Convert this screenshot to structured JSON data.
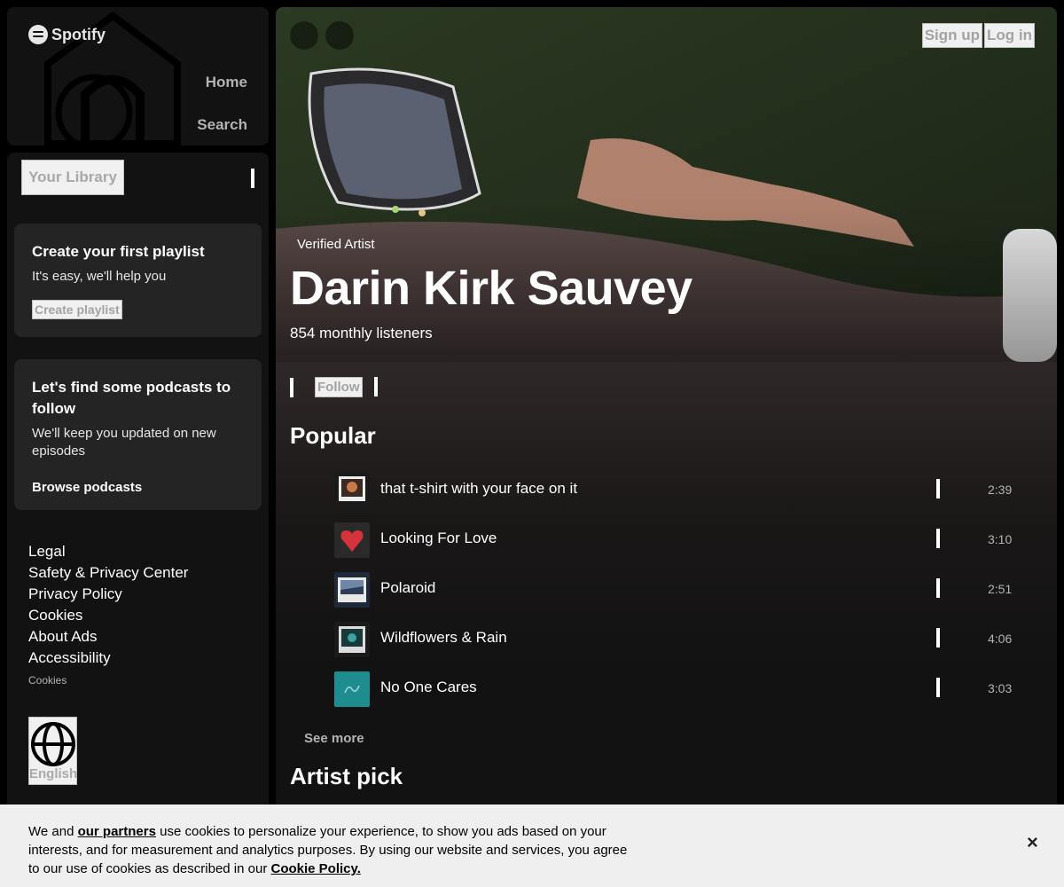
{
  "app": {
    "logo_text": "Spotify"
  },
  "nav": {
    "home_label": "Home",
    "search_label": "Search"
  },
  "library": {
    "button_label": "Your Library",
    "playlist_card": {
      "title": "Create your first playlist",
      "subtitle": "It's easy, we'll help you",
      "button_label": "Create playlist"
    },
    "podcast_card": {
      "title": "Let's find some podcasts to follow",
      "subtitle": "We'll keep you updated on new episodes",
      "link_label": "Browse podcasts"
    },
    "footer_links": [
      "Legal",
      "Safety & Privacy Center",
      "Privacy Policy",
      "Cookies",
      "About Ads",
      "Accessibility"
    ],
    "footer_small": "Cookies",
    "language_label": "English"
  },
  "header": {
    "signup_label": "Sign up",
    "login_label": "Log in"
  },
  "artist": {
    "verified_label": "Verified Artist",
    "name": "Darin Kirk Sauvey",
    "listeners": "854 monthly listeners",
    "follow_label": "Follow"
  },
  "popular": {
    "title": "Popular",
    "tracks": [
      {
        "title": "that t-shirt with your face on it",
        "duration": "2:39"
      },
      {
        "title": "Looking For Love",
        "duration": "3:10"
      },
      {
        "title": "Polaroid",
        "duration": "2:51"
      },
      {
        "title": "Wildflowers & Rain",
        "duration": "4:06"
      },
      {
        "title": "No One Cares",
        "duration": "3:03"
      }
    ],
    "see_more_label": "See more"
  },
  "artist_pick": {
    "title": "Artist pick"
  },
  "cookie_banner": {
    "text_before": "We and ",
    "partners_link": "our partners",
    "text_middle": " use cookies to personalize your experience, to show you ads based on your interests, and for measurement and analytics purposes. By using our website and services, you agree to our use of cookies as described in our ",
    "policy_link": "Cookie Policy.",
    "close_label": "×"
  },
  "colors": {
    "background": "#000000",
    "panel": "#121212",
    "card": "#242424",
    "accent_white": "#ffffff"
  }
}
